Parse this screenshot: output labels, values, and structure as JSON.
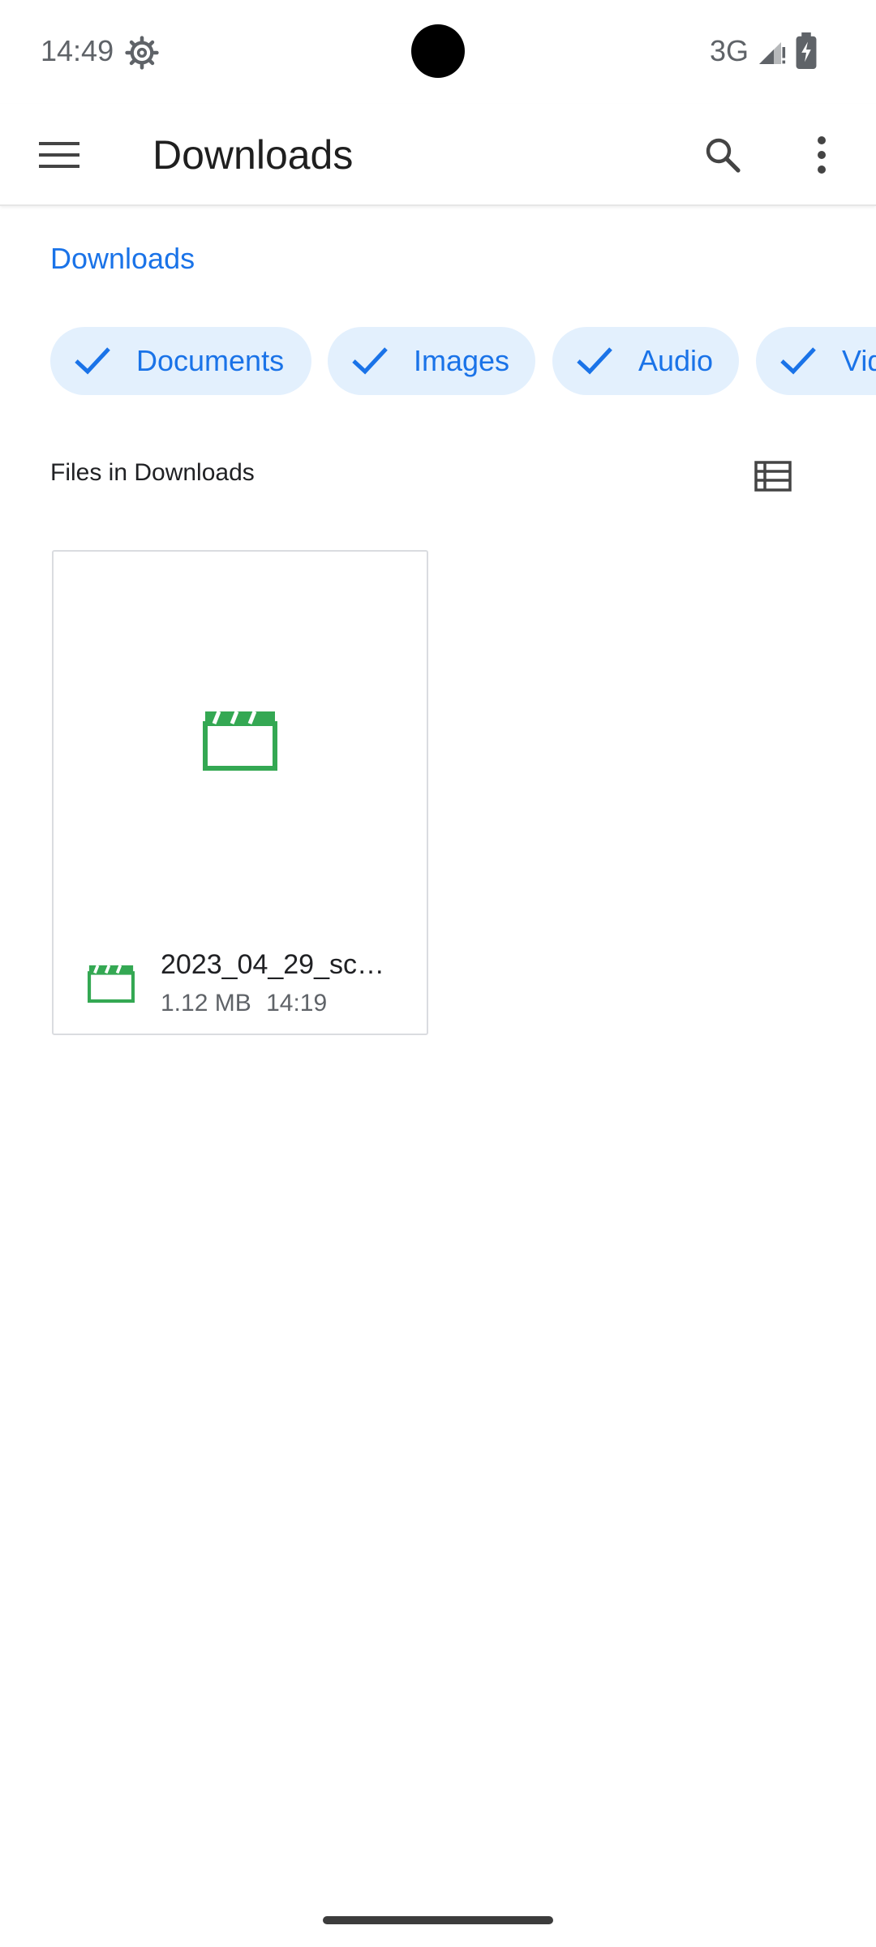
{
  "status_bar": {
    "time": "14:49",
    "network": "3G",
    "icons": [
      "gear-icon",
      "signal-icon",
      "battery-icon"
    ]
  },
  "app_bar": {
    "title": "Downloads",
    "icons": [
      "menu-icon",
      "search-icon",
      "more-vert-icon"
    ]
  },
  "breadcrumb": "Downloads",
  "filter_chips": [
    {
      "label": "Documents",
      "selected": true
    },
    {
      "label": "Images",
      "selected": true
    },
    {
      "label": "Audio",
      "selected": true
    },
    {
      "label": "Videos",
      "selected": true
    }
  ],
  "section": {
    "title": "Files in Downloads",
    "view_toggle_icon": "list-view-icon"
  },
  "files": [
    {
      "name": "2023_04_29_sc…",
      "size": "1.12 MB",
      "time": "14:19",
      "icon": "video-clapperboard-icon"
    }
  ],
  "colors": {
    "accent": "#1a73e8",
    "chip_bg": "#e3f0fd",
    "video_icon": "#34a853"
  }
}
